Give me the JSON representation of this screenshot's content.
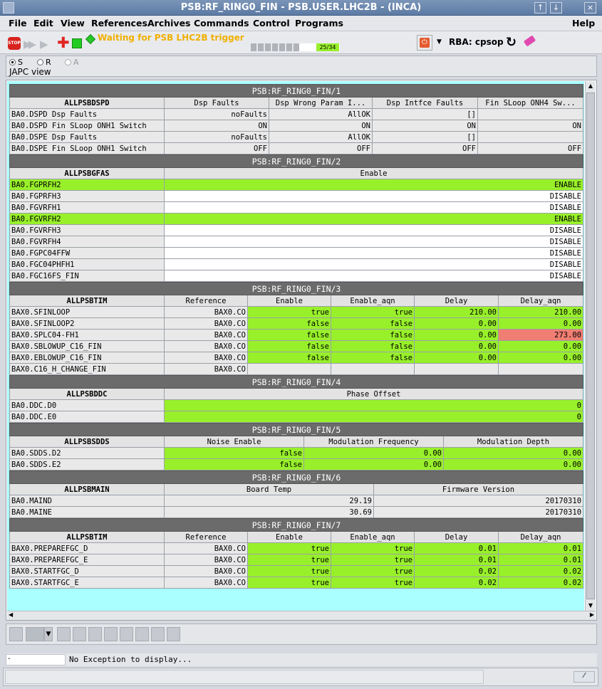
{
  "window": {
    "title": "PSB:RF_RING0_FIN - PSB.USER.LHC2B - (INCA)",
    "controls": [
      "↑",
      "↓",
      "×"
    ]
  },
  "menu": {
    "file": "File",
    "edit": "Edit",
    "view": "View",
    "references": "References",
    "archives": "Archives",
    "commands": "Commands",
    "control": "Control",
    "programs": "Programs",
    "help": "Help"
  },
  "toolbar": {
    "status_text": "Waiting for PSB LHC2B trigger",
    "progress": "25/34",
    "progress_fraction": 0.735,
    "rba": "RBA: cpsop",
    "stop_label": "STOP"
  },
  "selector": {
    "s": "S",
    "r": "R",
    "a": "A",
    "view_label": "JAPC view"
  },
  "sections": {
    "s1": {
      "title": "PSB:RF_RING0_FIN/1",
      "headers": [
        "ALLPSBDSPD",
        "Dsp Faults",
        "Dsp Wrong Param I...",
        "Dsp Intfce Faults",
        "Fin SLoop ONH4 Sw..."
      ],
      "rows": [
        [
          "BA0.DSPD Dsp Faults",
          "noFaults",
          "AllOK",
          "[]",
          ""
        ],
        [
          "BA0.DSPD Fin SLoop ONH1 Switch",
          "ON",
          "ON",
          "ON",
          "ON"
        ],
        [
          "BA0.DSPE Dsp Faults",
          "noFaults",
          "AllOK",
          "[]",
          ""
        ],
        [
          "BA0.DSPE Fin SLoop ONH1 Switch",
          "OFF",
          "OFF",
          "OFF",
          "OFF"
        ]
      ]
    },
    "s2": {
      "title": "PSB:RF_RING0_FIN/2",
      "headers": [
        "ALLPSBGFAS",
        "Enable"
      ],
      "rows": [
        [
          "BA0.FGPRFH2",
          "ENABLE"
        ],
        [
          "BA0.FGPRFH3",
          "DISABLE"
        ],
        [
          "BA0.FGVRFH1",
          "DISABLE"
        ],
        [
          "BA0.FGVRFH2",
          "ENABLE"
        ],
        [
          "BA0.FGVRFH3",
          "DISABLE"
        ],
        [
          "BA0.FGVRFH4",
          "DISABLE"
        ],
        [
          "BA0.FGPC04FFW",
          "DISABLE"
        ],
        [
          "BA0.FGC04PHFH1",
          "DISABLE"
        ],
        [
          "BA0.FGC16FS_FIN",
          "DISABLE"
        ]
      ]
    },
    "s3": {
      "title": "PSB:RF_RING0_FIN/3",
      "headers": [
        "ALLPSBTIM",
        "Reference",
        "Enable",
        "Enable_aqn",
        "Delay",
        "Delay_aqn"
      ],
      "rows": [
        [
          "BAX0.SFINLOOP",
          "BAX0.CO",
          "true",
          "true",
          "210.00",
          "210.00"
        ],
        [
          "BAX0.SFINLOOP2",
          "BAX0.CO",
          "false",
          "false",
          "0.00",
          "0.00"
        ],
        [
          "BAX0.SPLC04-FH1",
          "BAX0.CO",
          "false",
          "false",
          "0.00",
          "273.00"
        ],
        [
          "BAX0.SBLOWUP_C16_FIN",
          "BAX0.CO",
          "false",
          "false",
          "0.00",
          "0.00"
        ],
        [
          "BAX0.EBLOWUP_C16_FIN",
          "BAX0.CO",
          "false",
          "false",
          "0.00",
          "0.00"
        ],
        [
          "BAX0.C16_H_CHANGE_FIN",
          "BAX0.CO",
          "",
          "",
          "",
          ""
        ]
      ]
    },
    "s4": {
      "title": "PSB:RF_RING0_FIN/4",
      "headers": [
        "ALLPSBDDC",
        "Phase Offset"
      ],
      "rows": [
        [
          "BA0.DDC.D0",
          "0"
        ],
        [
          "BA0.DDC.E0",
          "0"
        ]
      ]
    },
    "s5": {
      "title": "PSB:RF_RING0_FIN/5",
      "headers": [
        "ALLPSBSDDS",
        "Noise Enable",
        "Modulation Frequency",
        "Modulation Depth"
      ],
      "rows": [
        [
          "BA0.SDDS.D2",
          "false",
          "0.00",
          "0.00"
        ],
        [
          "BA0.SDDS.E2",
          "false",
          "0.00",
          "0.00"
        ]
      ]
    },
    "s6": {
      "title": "PSB:RF_RING0_FIN/6",
      "headers": [
        "ALLPSBMAIN",
        "Board Temp",
        "Firmware Version"
      ],
      "rows": [
        [
          "BA0.MAIND",
          "29.19",
          "20170310"
        ],
        [
          "BA0.MAINE",
          "30.69",
          "20170310"
        ]
      ]
    },
    "s7": {
      "title": "PSB:RF_RING0_FIN/7",
      "headers": [
        "ALLPSBTIM",
        "Reference",
        "Enable",
        "Enable_aqn",
        "Delay",
        "Delay_aqn"
      ],
      "rows": [
        [
          "BAX0.PREPAREFGC_D",
          "BAX0.CO",
          "true",
          "true",
          "0.01",
          "0.01"
        ],
        [
          "BAX0.PREPAREFGC_E",
          "BAX0.CO",
          "true",
          "true",
          "0.01",
          "0.01"
        ],
        [
          "BAX0.STARTFGC_D",
          "BAX0.CO",
          "true",
          "true",
          "0.02",
          "0.02"
        ],
        [
          "BAX0.STARTFGC_E",
          "BAX0.CO",
          "true",
          "true",
          "0.02",
          "0.02"
        ]
      ]
    }
  },
  "exception": {
    "field": "-",
    "message": "No Exception to display..."
  },
  "colors": {
    "green": "#98f02a",
    "red": "#f07e72",
    "header": "#6b6b6b",
    "cyan": "#aaffff",
    "status_orange": "#f0b000"
  }
}
